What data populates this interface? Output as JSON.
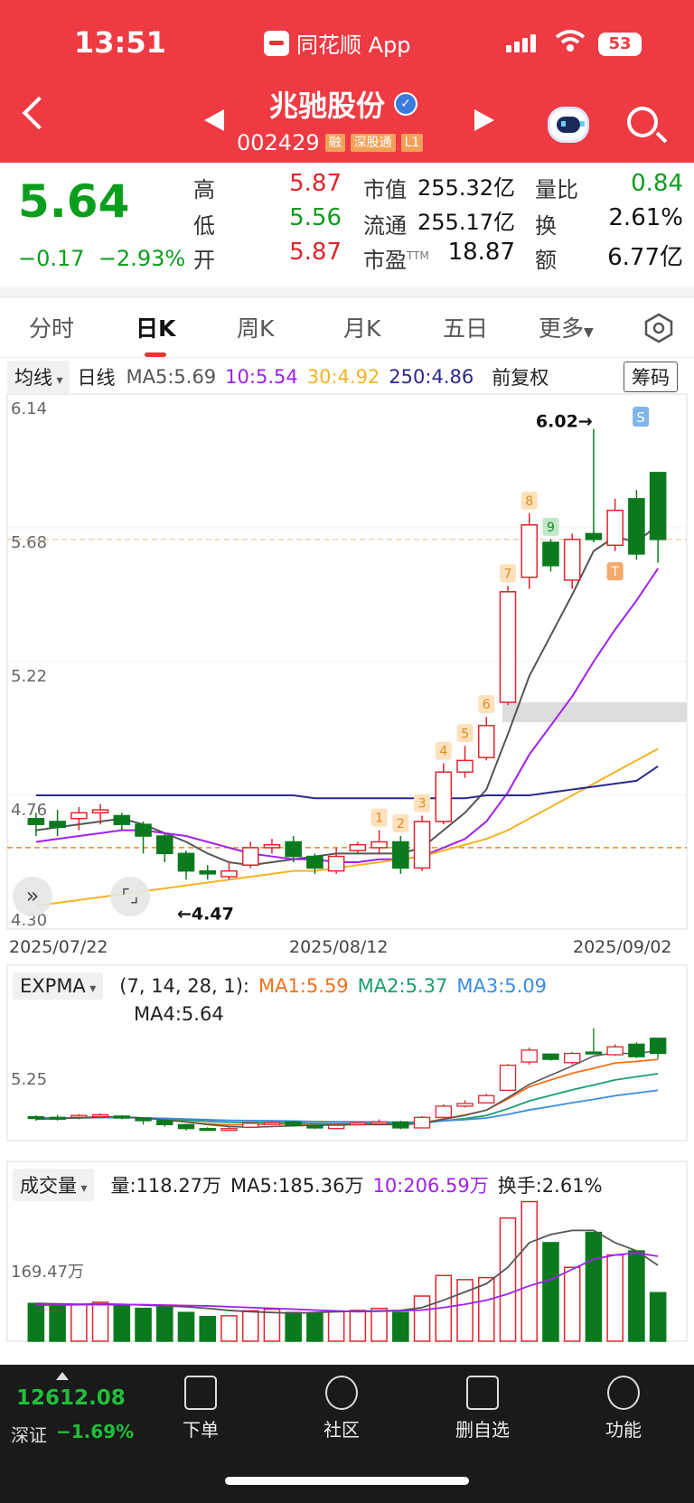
{
  "status": {
    "time": "13:51",
    "app": "同花顺 App",
    "battery": "53"
  },
  "header": {
    "name": "兆驰股份",
    "code": "002429",
    "tags": [
      "融",
      "深股通",
      "L1"
    ]
  },
  "quote": {
    "price": "5.64",
    "change": "−0.17",
    "pct": "−2.93%",
    "rows": [
      {
        "k1": "高",
        "v1": "5.87",
        "k2": "市值",
        "v2": "255.32亿",
        "k3": "量比",
        "v3": "0.84"
      },
      {
        "k1": "低",
        "v1": "5.56",
        "k2": "流通",
        "v2": "255.17亿",
        "k3": "换",
        "v3": "2.61%"
      },
      {
        "k1": "开",
        "v1": "5.87",
        "k2": "市盈",
        "k2sup": "TTM",
        "v2": "18.87",
        "k3": "额",
        "v3": "6.77亿"
      }
    ]
  },
  "tabs": [
    "分时",
    "日K",
    "周K",
    "月K",
    "五日",
    "更多"
  ],
  "ma_line": {
    "dropdown": "均线",
    "period": "日线",
    "ma5": "MA5:5.69",
    "ma10": "10:5.54",
    "ma30": "30:4.92",
    "ma250": "250:4.86",
    "fq": "前复权",
    "chip": "筹码"
  },
  "kline": {
    "y_labels": [
      "6.14",
      "5.68",
      "5.22",
      "4.76",
      "4.30"
    ],
    "dates": [
      "2025/07/22",
      "2025/08/12",
      "2025/09/02"
    ],
    "high_note": "6.02→",
    "low_note": "←4.47",
    "s_marker": "S",
    "t_marker": "T"
  },
  "expma": {
    "dropdown": "EXPMA",
    "params": "(7, 14, 28, 1):",
    "ma1": "MA1:5.59",
    "ma2": "MA2:5.37",
    "ma3": "MA3:5.09",
    "ma4": "MA4:5.64",
    "y_label": "5.25"
  },
  "volume": {
    "dropdown": "成交量",
    "vol": "量:118.27万",
    "ma5": "MA5:185.36万",
    "ma10": "10:206.59万",
    "turnover": "换手:2.61%",
    "y_label": "169.47万"
  },
  "colors": {
    "up": "#e0242c",
    "down": "#0b7a1e",
    "ma5": "#555555",
    "ma10": "#a020f0",
    "ma30": "#f5b325",
    "ma250": "#2a2a8c"
  },
  "bottom": {
    "index_value": "12612.08",
    "index_name": "深证",
    "index_change": "−1.69%",
    "nav": [
      "下单",
      "社区",
      "删自选",
      "功能"
    ]
  },
  "chart_data": {
    "type": "candlestick",
    "title": "",
    "ylim": [
      4.3,
      6.14
    ],
    "dates": [
      "2025/07/22",
      "",
      "",
      "",
      "",
      "",
      "",
      "",
      "",
      "",
      "",
      "",
      "",
      "",
      "2025/08/12",
      "",
      "",
      "",
      "",
      "",
      "",
      "",
      "",
      "",
      "",
      "",
      "",
      "",
      "",
      "2025/09/02"
    ],
    "ohlc": [
      [
        4.68,
        4.66,
        4.7,
        4.62
      ],
      [
        4.67,
        4.65,
        4.71,
        4.62
      ],
      [
        4.68,
        4.7,
        4.72,
        4.64
      ],
      [
        4.7,
        4.71,
        4.73,
        4.66
      ],
      [
        4.69,
        4.66,
        4.7,
        4.64
      ],
      [
        4.66,
        4.62,
        4.67,
        4.56
      ],
      [
        4.62,
        4.56,
        4.63,
        4.53
      ],
      [
        4.56,
        4.5,
        4.57,
        4.47
      ],
      [
        4.5,
        4.49,
        4.52,
        4.47
      ],
      [
        4.48,
        4.5,
        4.53,
        4.47
      ],
      [
        4.52,
        4.58,
        4.6,
        4.51
      ],
      [
        4.58,
        4.59,
        4.61,
        4.56
      ],
      [
        4.6,
        4.55,
        4.62,
        4.53
      ],
      [
        4.55,
        4.51,
        4.56,
        4.49
      ],
      [
        4.5,
        4.55,
        4.58,
        4.49
      ],
      [
        4.57,
        4.59,
        4.6,
        4.56
      ],
      [
        4.58,
        4.6,
        4.64,
        4.56
      ],
      [
        4.6,
        4.51,
        4.62,
        4.49
      ],
      [
        4.51,
        4.67,
        4.69,
        4.5
      ],
      [
        4.67,
        4.84,
        4.87,
        4.66
      ],
      [
        4.84,
        4.88,
        4.93,
        4.82
      ],
      [
        4.89,
        5.0,
        5.03,
        4.88
      ],
      [
        5.08,
        5.46,
        5.48,
        5.07
      ],
      [
        5.51,
        5.69,
        5.73,
        5.47
      ],
      [
        5.63,
        5.55,
        5.64,
        5.53
      ],
      [
        5.5,
        5.64,
        5.66,
        5.47
      ],
      [
        5.66,
        5.64,
        6.02,
        5.63
      ],
      [
        5.62,
        5.74,
        5.78,
        5.6
      ],
      [
        5.78,
        5.59,
        5.81,
        5.57
      ],
      [
        5.87,
        5.64,
        5.87,
        5.56
      ]
    ],
    "series": [
      {
        "name": "MA5",
        "values": [
          4.64,
          4.65,
          4.66,
          4.67,
          4.68,
          4.66,
          4.63,
          4.6,
          4.56,
          4.53,
          4.52,
          4.53,
          4.54,
          4.55,
          4.56,
          4.56,
          4.56,
          4.56,
          4.58,
          4.64,
          4.7,
          4.78,
          4.97,
          5.17,
          5.31,
          5.45,
          5.6,
          5.65,
          5.63,
          5.69
        ]
      },
      {
        "name": "10",
        "values": [
          4.6,
          4.61,
          4.62,
          4.63,
          4.64,
          4.64,
          4.63,
          4.62,
          4.6,
          4.58,
          4.56,
          4.55,
          4.54,
          4.54,
          4.53,
          4.53,
          4.54,
          4.54,
          4.55,
          4.58,
          4.61,
          4.67,
          4.77,
          4.9,
          5.0,
          5.1,
          5.22,
          5.33,
          5.43,
          5.54
        ]
      },
      {
        "name": "30",
        "values": [
          4.38,
          4.39,
          4.4,
          4.41,
          4.42,
          4.43,
          4.44,
          4.45,
          4.46,
          4.47,
          4.48,
          4.49,
          4.5,
          4.5,
          4.51,
          4.52,
          4.53,
          4.54,
          4.55,
          4.57,
          4.59,
          4.61,
          4.64,
          4.68,
          4.72,
          4.76,
          4.8,
          4.84,
          4.88,
          4.92
        ]
      },
      {
        "name": "250",
        "values": [
          4.76,
          4.76,
          4.76,
          4.76,
          4.76,
          4.76,
          4.76,
          4.76,
          4.76,
          4.76,
          4.76,
          4.76,
          4.76,
          4.75,
          4.75,
          4.75,
          4.75,
          4.75,
          4.75,
          4.75,
          4.75,
          4.76,
          4.76,
          4.76,
          4.77,
          4.78,
          4.79,
          4.8,
          4.81,
          4.86
        ]
      }
    ],
    "td_labels": [
      [
        16,
        "1"
      ],
      [
        17,
        "2"
      ],
      [
        18,
        "3"
      ],
      [
        19,
        "4"
      ],
      [
        20,
        "5"
      ],
      [
        21,
        "6"
      ],
      [
        22,
        "7"
      ],
      [
        23,
        "8"
      ],
      [
        24,
        "9"
      ]
    ],
    "volume": [
      92,
      88,
      90,
      95,
      88,
      80,
      85,
      70,
      60,
      62,
      74,
      78,
      70,
      68,
      72,
      75,
      80,
      70,
      110,
      160,
      150,
      155,
      300,
      340,
      240,
      180,
      265,
      210,
      220,
      118.27
    ],
    "volume_ma": [
      {
        "name": "MA5",
        "values": [
          92,
          91,
          90,
          91,
          90,
          88,
          86,
          84,
          80,
          75,
          72,
          70,
          68,
          70,
          72,
          73,
          74,
          75,
          82,
          100,
          120,
          140,
          180,
          240,
          260,
          270,
          270,
          240,
          220,
          185
        ]
      },
      {
        "name": "10",
        "values": [
          88,
          88,
          89,
          89,
          89,
          89,
          88,
          87,
          86,
          84,
          82,
          80,
          78,
          76,
          74,
          72,
          73,
          74,
          76,
          82,
          90,
          100,
          115,
          135,
          150,
          175,
          200,
          210,
          215,
          207
        ]
      }
    ]
  }
}
